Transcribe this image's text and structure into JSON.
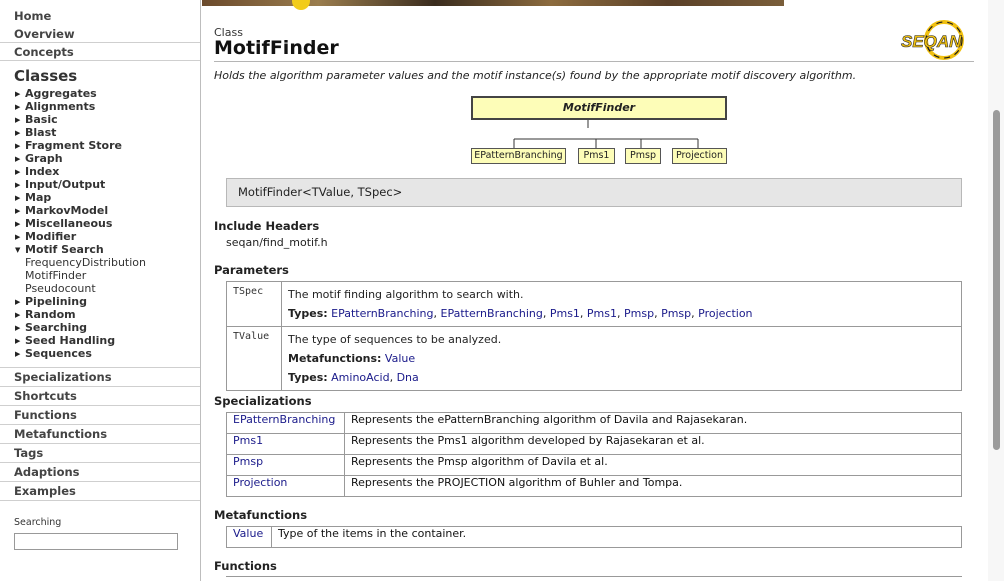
{
  "sidebar": {
    "top": [
      "Home",
      "Overview",
      "Concepts"
    ],
    "classes_title": "Classes",
    "classes": [
      {
        "label": "Aggregates",
        "expanded": false
      },
      {
        "label": "Alignments",
        "expanded": false
      },
      {
        "label": "Basic",
        "expanded": false
      },
      {
        "label": "Blast",
        "expanded": false
      },
      {
        "label": "Fragment Store",
        "expanded": false
      },
      {
        "label": "Graph",
        "expanded": false
      },
      {
        "label": "Index",
        "expanded": false
      },
      {
        "label": "Input/Output",
        "expanded": false
      },
      {
        "label": "Map",
        "expanded": false
      },
      {
        "label": "MarkovModel",
        "expanded": false
      },
      {
        "label": "Miscellaneous",
        "expanded": false
      },
      {
        "label": "Modifier",
        "expanded": false
      },
      {
        "label": "Motif Search",
        "expanded": true
      },
      {
        "label": "Pipelining",
        "expanded": false
      },
      {
        "label": "Random",
        "expanded": false
      },
      {
        "label": "Searching",
        "expanded": false
      },
      {
        "label": "Seed Handling",
        "expanded": false
      },
      {
        "label": "Sequences",
        "expanded": false
      }
    ],
    "motif_children": [
      "FrequencyDistribution",
      "MotifFinder",
      "Pseudocount"
    ],
    "bottom": [
      "Specializations",
      "Shortcuts",
      "Functions",
      "Metafunctions",
      "Tags",
      "Adaptions",
      "Examples"
    ],
    "search_label": "Searching",
    "search_value": ""
  },
  "page": {
    "kind": "Class",
    "title": "MotifFinder",
    "logo_text": "SEQAN",
    "description": "Holds the algorithm parameter values and the motif instance(s) found by the appropriate motif discovery algorithm.",
    "signature": "MotifFinder<TValue, TSpec>"
  },
  "diagram": {
    "root": "MotifFinder",
    "children": [
      "EPatternBranching",
      "Pms1",
      "Pmsp",
      "Projection"
    ]
  },
  "headers": {
    "title": "Include Headers",
    "value": "seqan/find_motif.h"
  },
  "parameters": {
    "title": "Parameters",
    "types_label": "Types:",
    "metafunctions_label": "Metafunctions:",
    "rows": [
      {
        "name": "TSpec",
        "desc": "The motif finding algorithm to search with.",
        "types": [
          "EPatternBranching",
          "EPatternBranching",
          "Pms1",
          "Pms1",
          "Pmsp",
          "Pmsp",
          "Projection"
        ]
      },
      {
        "name": "TValue",
        "desc": "The type of sequences to be analyzed.",
        "metafunctions": [
          "Value"
        ],
        "types": [
          "AminoAcid",
          "Dna"
        ]
      }
    ]
  },
  "specializations": {
    "title": "Specializations",
    "rows": [
      {
        "name": "EPatternBranching",
        "desc": "Represents the ePatternBranching algorithm of Davila and Rajasekaran."
      },
      {
        "name": "Pms1",
        "desc": "Represents the Pms1 algorithm developed by Rajasekaran et al."
      },
      {
        "name": "Pmsp",
        "desc": "Represents the Pmsp algorithm of Davila et al."
      },
      {
        "name": "Projection",
        "desc": "Represents the PROJECTION algorithm of Buhler and Tompa."
      }
    ]
  },
  "metafunctions": {
    "title": "Metafunctions",
    "rows": [
      {
        "name": "Value",
        "desc": "Type of the items in the container."
      }
    ]
  },
  "functions": {
    "title": "Functions"
  }
}
